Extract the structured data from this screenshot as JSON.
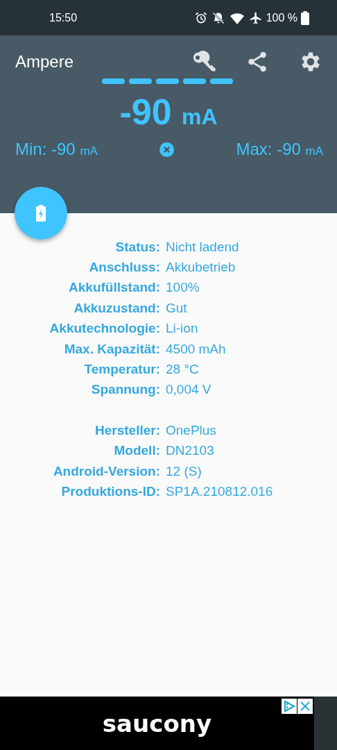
{
  "status_bar": {
    "time": "15:50",
    "battery_text": "100 %"
  },
  "app_bar": {
    "title": "Ampere"
  },
  "reading": {
    "value": "-90",
    "unit": "mA",
    "min_label": "Min:",
    "min_value": "-90",
    "min_unit": "mA",
    "max_label": "Max:",
    "max_value": "-90",
    "max_unit": "mA"
  },
  "info_groups": [
    {
      "rows": [
        {
          "label": "Status:",
          "value": "Nicht ladend"
        },
        {
          "label": "Anschluss:",
          "value": "Akkubetrieb"
        },
        {
          "label": "Akkufüllstand:",
          "value": "100%"
        },
        {
          "label": "Akkuzustand:",
          "value": "Gut"
        },
        {
          "label": "Akkutechnologie:",
          "value": "Li-ion"
        },
        {
          "label": "Max. Kapazität:",
          "value": "4500 mAh"
        },
        {
          "label": "Temperatur:",
          "value": "28 °C"
        },
        {
          "label": "Spannung:",
          "value": "0,004 V"
        }
      ]
    },
    {
      "rows": [
        {
          "label": "Hersteller:",
          "value": "OnePlus"
        },
        {
          "label": "Modell:",
          "value": "DN2103"
        },
        {
          "label": "Android-Version:",
          "value": "12 (S)"
        },
        {
          "label": "Produktions-ID:",
          "value": "SP1A.210812.016"
        }
      ]
    }
  ],
  "ad_banner": {
    "brand": "saucony"
  }
}
